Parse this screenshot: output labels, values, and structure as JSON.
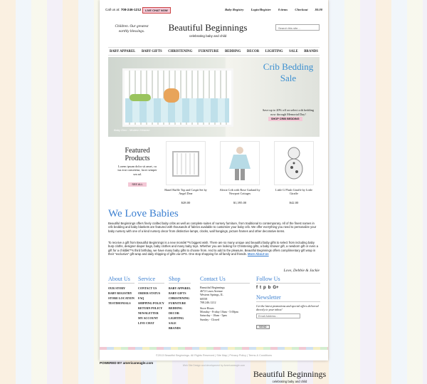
{
  "topbar": {
    "call_label": "Call us at:",
    "phone": "708-246-1212",
    "live_chat": "LIVE CHAT NOW",
    "links": [
      "Baby Registry",
      "Login/Register",
      "0 items",
      "Checkout",
      "$0.00"
    ]
  },
  "header": {
    "tagline": "Children. Our greatest earthly blessings.",
    "logo_name": "Beautiful Beginnings",
    "logo_tagline": "celebrating baby and child",
    "search_placeholder": "Search this site..."
  },
  "nav": [
    "BABY APPAREL",
    "BABY GIFTS",
    "CHRISTENING",
    "FURNITURE",
    "BEDDING",
    "DECOR",
    "LIGHTING",
    "SALE",
    "BRANDS"
  ],
  "hero": {
    "title": "Crib Bedding Sale",
    "subtitle": "Save up to 20% off on select crib bedding now through Memorial Day!",
    "button": "SHOP CRIB BEDDING",
    "caption": "Baby Dino - Modern Heaven"
  },
  "featured": {
    "heading": "Featured Products",
    "text": "Lorem ipsum dolor sit amet, cu ius erat consetetur, facer semper sea ad.",
    "button": "SEE ALL"
  },
  "products": [
    {
      "name": "Hanel Ruffle Top and Caspit Set by Angel Dear",
      "price": "$28.00"
    },
    {
      "name": "Alexis Crib with Rose Garland by Newport Cottages",
      "price": "$1,395.00"
    },
    {
      "name": "Little G Plush Giraffe by Little Giraffe",
      "price": "$42.00"
    }
  ],
  "love": {
    "heading": "We Love Babies",
    "p1": "Beautiful Beginnings offers finely crafted baby cribs as well as complete suites of nursery furniture, from traditional to contemporary. All of the finest names in crib bedding and baby blankets are featured with thousands of fabrics available to customize your baby crib. We offer everything you need to personalize your baby nursery with one of a kind nursery decor from distinctive lamps, clocks, wall hangings, picture frames and other decorative items.",
    "p2": "To receive a gift from Beautiful Beginnings is a new momâ€™s biggest wish. There are so many unique and beautiful baby gifts to select from including baby burp cloths, designer diaper bags, baby clothes and many baby toys. Whether you are looking for Christening gifts, a baby shower gift, a newborn gift or even a gift for a childâ€™s third birthday, we have many baby gifts to choose from. And to add to the pleasure, Beautiful Beginnings offers complimentary gift wrap in their “exclusive” gift wrap and daily shipping of gifts via UPS. One stop shopping for all family and friends.",
    "more": "More About Us",
    "signature": "Love, Debbie & Jackie"
  },
  "footer": {
    "about": {
      "heading": "About Us",
      "items": [
        "OUR STORY",
        "BABY REGISTRY",
        "STORE LOCATION",
        "TESTIMONIALS"
      ]
    },
    "service": {
      "heading": "Service",
      "items": [
        "CONTACT US",
        "ORDER STATUS",
        "FAQ",
        "SHIPPING POLICY",
        "RETURN POLICY",
        "NEWSLETTER",
        "MY ACCOUNT",
        "LIVE CHAT"
      ]
    },
    "shop": {
      "heading": "Shop",
      "items": [
        "BABY APPAREL",
        "BABY GIFTS",
        "CHRISTENING",
        "FURNITURE",
        "BEDDING",
        "DECOR",
        "LIGHTING",
        "SALE",
        "BRANDS"
      ]
    },
    "contact": {
      "heading": "Contact Us",
      "lines": [
        "Beautiful Beginnings",
        "4672 Lawn Avenue",
        "Western Springs, IL",
        "60558",
        "708.246.1212"
      ],
      "hours_heading": "Store Hours",
      "hours": [
        "Monday - Friday 10am - 5:00pm",
        "Saturday - 10am - 5pm",
        "Sunday - Closed"
      ]
    },
    "follow": {
      "heading": "Follow Us",
      "icons": [
        "f",
        "t",
        "p",
        "b",
        "G+"
      ]
    },
    "newsletter": {
      "heading": "Newsletter",
      "text": "Get the latest promotions and special offers delivered directly to your inbox!",
      "placeholder": "Email Address...",
      "button": "SEND"
    }
  },
  "bottom": {
    "copyright": "©2013 Beautiful Beginnings. All Rights Reserved",
    "links": [
      "Site Map",
      "Privacy Policy",
      "Terms & Conditions"
    ],
    "credit": "Web Site Design and development by Americaneagle.com",
    "powered": "POWERED BY americaneagle.com"
  },
  "footer_logo": {
    "name": "Beautiful Beginnings",
    "tagline": "celebrating baby and child"
  }
}
